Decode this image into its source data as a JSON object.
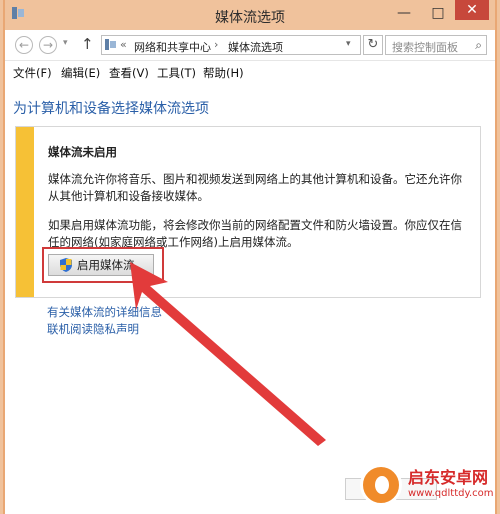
{
  "window": {
    "title": "媒体流选项",
    "minimize_glyph": "—",
    "maximize_glyph": "□",
    "close_glyph": "✕"
  },
  "navigation": {
    "back_glyph": "←",
    "forward_glyph": "→",
    "up_glyph": "↑",
    "overflow_glyph": "«",
    "breadcrumbs": [
      "网络和共享中心",
      "媒体流选项"
    ],
    "separator_glyph": "›",
    "refresh_glyph": "↻",
    "search_placeholder": "搜索控制面板"
  },
  "menu": {
    "items": [
      "文件(F)",
      "编辑(E)",
      "查看(V)",
      "工具(T)",
      "帮助(H)"
    ]
  },
  "content": {
    "title": "为计算机和设备选择媒体流选项",
    "panel": {
      "heading": "媒体流未启用",
      "paragraph1": "媒体流允许你将音乐、图片和视频发送到网络上的其他计算机和设备。它还允许你从其他计算机和设备接收媒体。",
      "paragraph2": "如果启用媒体流功能，将会修改你当前的网络配置文件和防火墙设置。你应仅在信任的网络(如家庭网络或工作网络)上启用媒体流。",
      "button_label": "启用媒体流"
    },
    "links": [
      "有关媒体流的详细信息",
      "联机阅读隐私声明"
    ]
  },
  "watermark": {
    "name": "启东安卓网",
    "url": "www.qdlttdy.com"
  },
  "colors": {
    "accent_link": "#2a5fa8",
    "warning_strip": "#f6c136",
    "annotation_red": "#d03a3a",
    "title_bar": "#f0c29c"
  }
}
